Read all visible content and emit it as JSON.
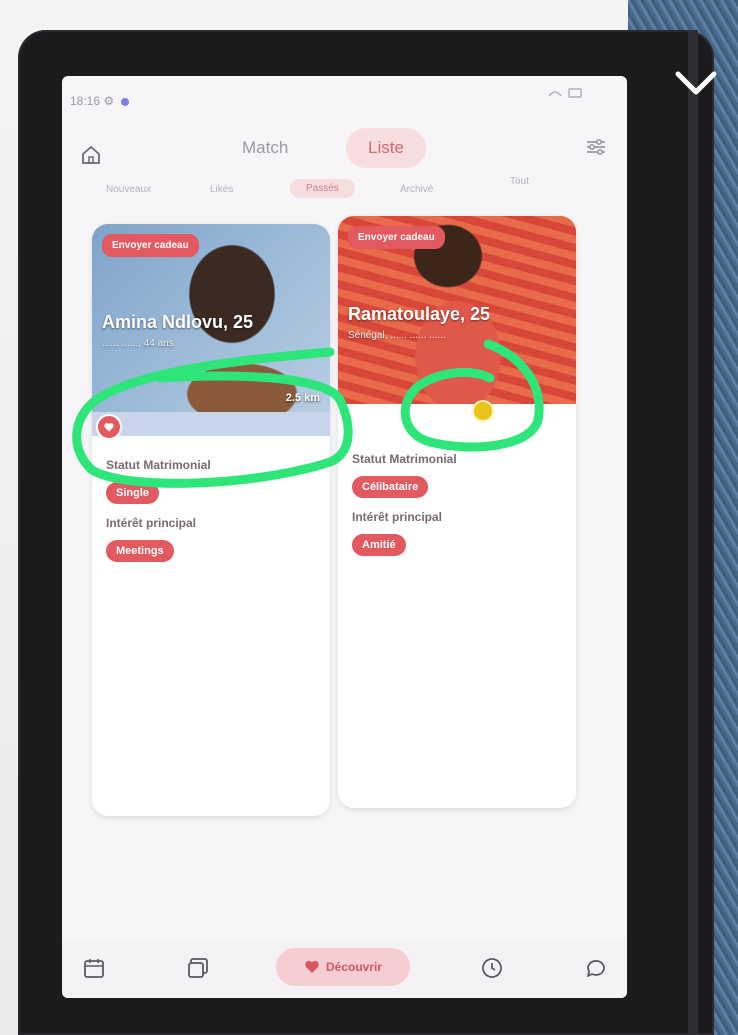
{
  "status_bar": {
    "carrier": "18:16 ⚙"
  },
  "top_tabs": {
    "match": "Match",
    "liste": "Liste"
  },
  "sub_tabs": [
    "Nouveaux",
    "Likés",
    "Passés",
    "Archivé",
    "Tout"
  ],
  "cards": [
    {
      "gift": "Envoyer cadeau",
      "name": "Amina Ndlovu, 25",
      "subinfo": "...... ......, 44 ans",
      "distance": "2.5 km",
      "status_label": "Statut Matrimonial",
      "status_value": "Single",
      "interest_label": "Intérêt principal",
      "interest_value": "Meetings"
    },
    {
      "gift": "Envoyer cadeau",
      "name": "Ramatoulaye, 25",
      "subinfo": "Sénégal, ...... ...... ......",
      "status_label": "Statut Matrimonial",
      "status_value": "Célibataire",
      "interest_label": "Intérêt principal",
      "interest_value": "Amitié"
    }
  ],
  "bottom_nav": {
    "discover": "Découvrir"
  },
  "accent_colors": {
    "primary": "#e2595f",
    "pill_bg": "#f6dde0",
    "highlight": "#2ee57a"
  }
}
